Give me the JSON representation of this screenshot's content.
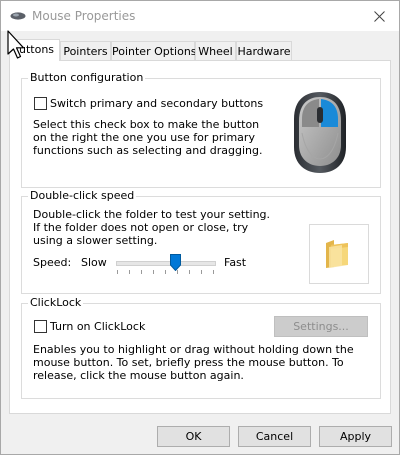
{
  "window": {
    "title": "Mouse Properties"
  },
  "tabs": [
    {
      "label": "Buttons",
      "visible_label": "uttons",
      "active": true
    },
    {
      "label": "Pointers",
      "active": false
    },
    {
      "label": "Pointer Options",
      "active": false
    },
    {
      "label": "Wheel",
      "active": false
    },
    {
      "label": "Hardware",
      "active": false
    }
  ],
  "button_config": {
    "title": "Button configuration",
    "checkbox_label": "Switch primary and secondary buttons",
    "checked": false,
    "description": "Select this check box to make the button on the right the one you use for primary functions such as selecting and dragging."
  },
  "double_click": {
    "title": "Double-click speed",
    "description": "Double-click the folder to test your setting. If the folder does not open or close, try using a slower setting.",
    "speed_label": "Speed:",
    "slow_label": "Slow",
    "fast_label": "Fast",
    "speed_level": 0.6
  },
  "clicklock": {
    "title": "ClickLock",
    "checkbox_label": "Turn on ClickLock",
    "checked": false,
    "settings_label": "Settings...",
    "settings_enabled": false,
    "description": "Enables you to highlight or drag without holding down the mouse button. To set, briefly press the mouse button. To release, click the mouse button again."
  },
  "footer": {
    "ok_label": "OK",
    "cancel_label": "Cancel",
    "apply_label": "Apply"
  },
  "icons": {
    "title_icon": "mouse-icon",
    "close_icon": "close-icon",
    "mouse_image": "mouse-illustration",
    "folder_image": "folder-icon",
    "cursor": "arrow-cursor-icon"
  }
}
